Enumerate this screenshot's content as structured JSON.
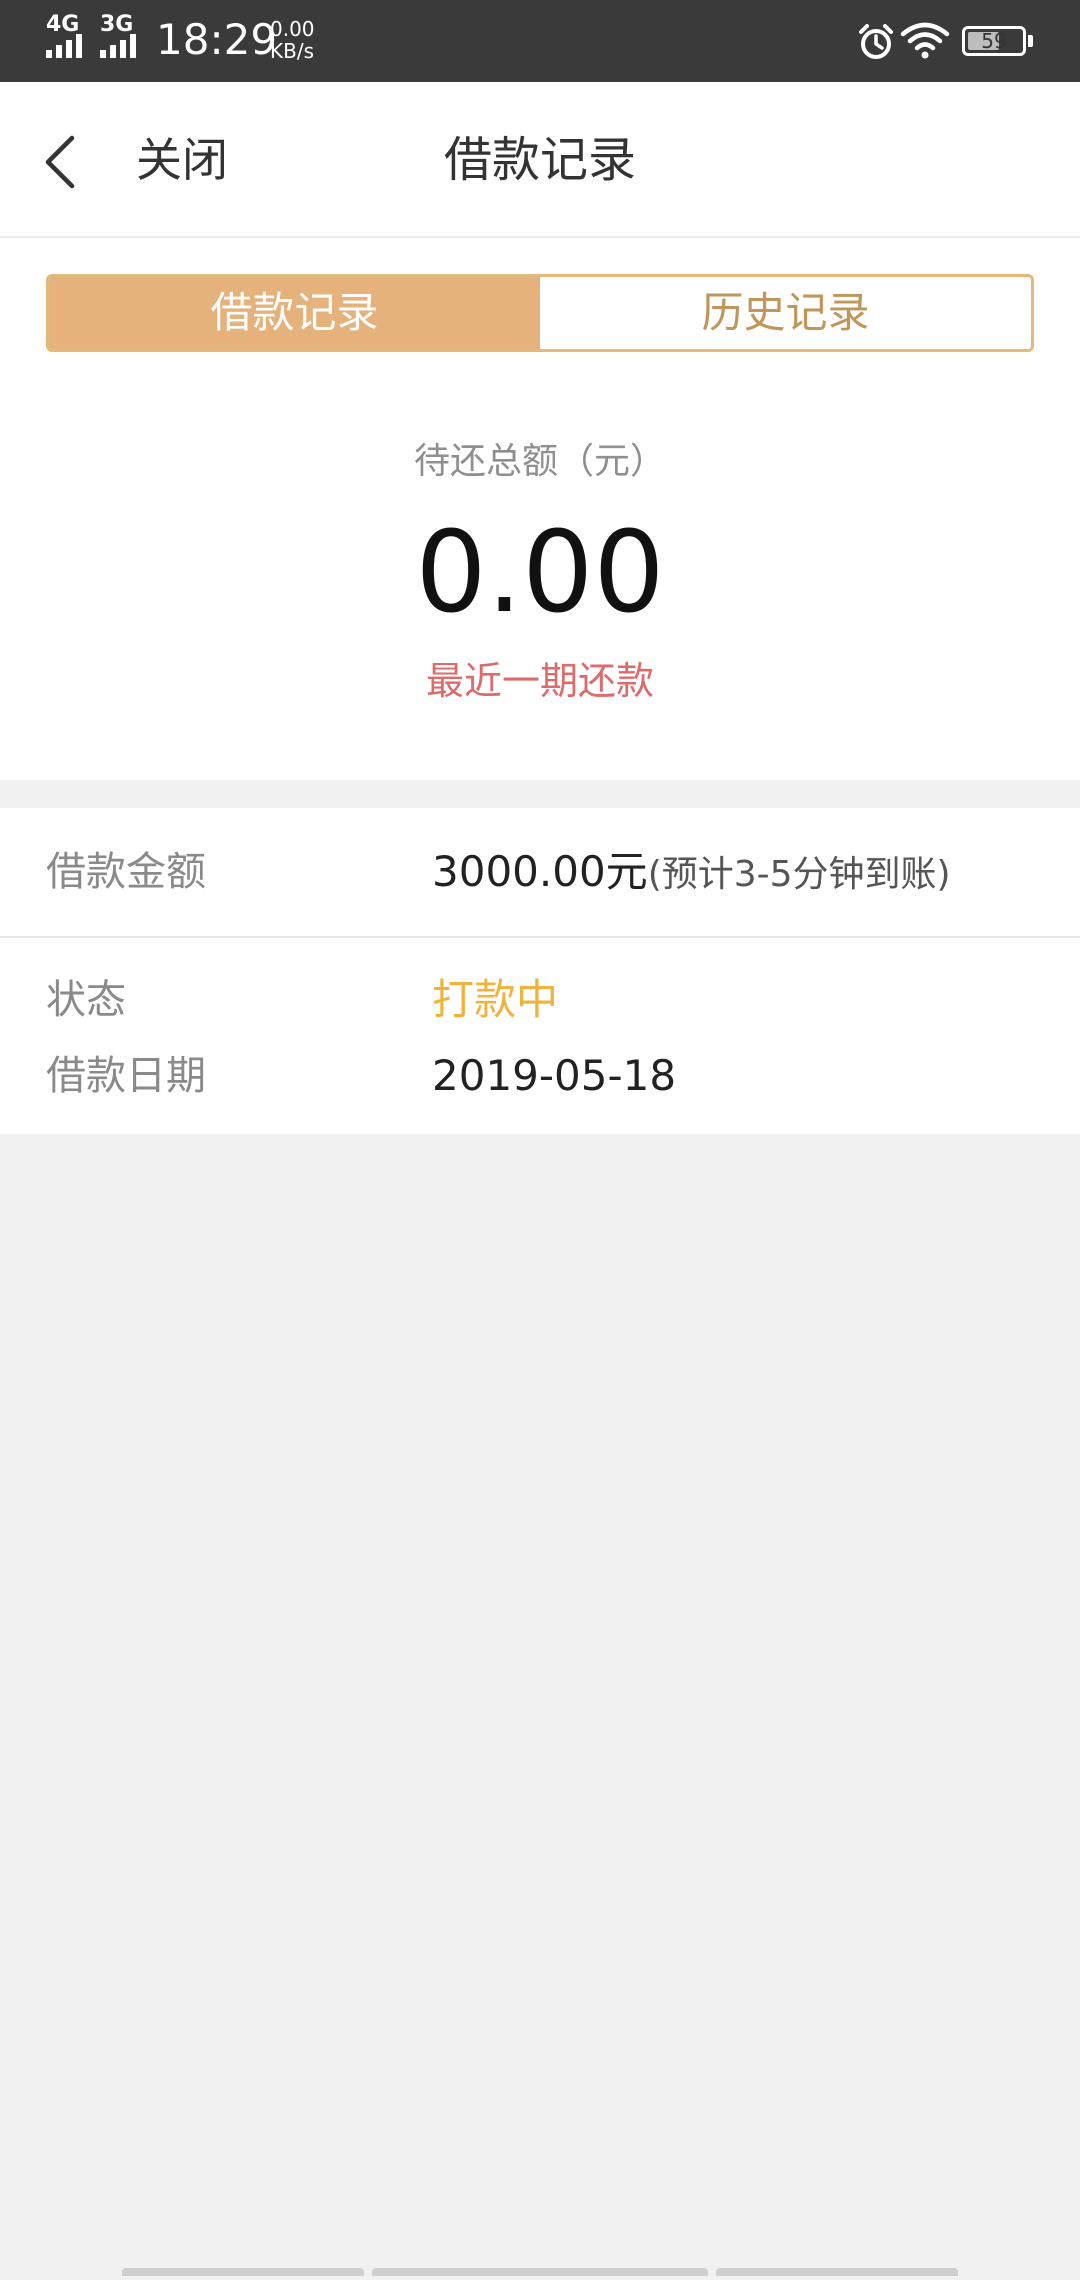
{
  "status_bar": {
    "network_1": "4G",
    "network_2": "3G",
    "time": "18:29",
    "speed_value": "0.00",
    "speed_unit": "KB/s",
    "battery": "59",
    "battery_level": 0.59
  },
  "nav": {
    "close_label": "关闭",
    "title": "借款记录"
  },
  "tabs": [
    {
      "label": "借款记录",
      "active": true
    },
    {
      "label": "历史记录",
      "active": false
    }
  ],
  "summary": {
    "label": "待还总额（元）",
    "amount": "0.00",
    "recent_label": "最近一期还款"
  },
  "details": {
    "amount_label": "借款金额",
    "amount_value": "3000.00元",
    "amount_note": "(预计3-5分钟到账)",
    "status_label": "状态",
    "status_value": "打款中",
    "date_label": "借款日期",
    "date_value": "2019-05-18"
  },
  "colors": {
    "accent": "#e6b27c",
    "accent_text": "#c0965a",
    "recent_red": "#de6b6b",
    "status_yellow": "#f0b33d",
    "background": "#f1f1f1"
  },
  "icons": {
    "back": "chevron-left-icon",
    "alarm": "alarm-icon",
    "wifi": "wifi-icon",
    "battery": "battery-icon"
  }
}
